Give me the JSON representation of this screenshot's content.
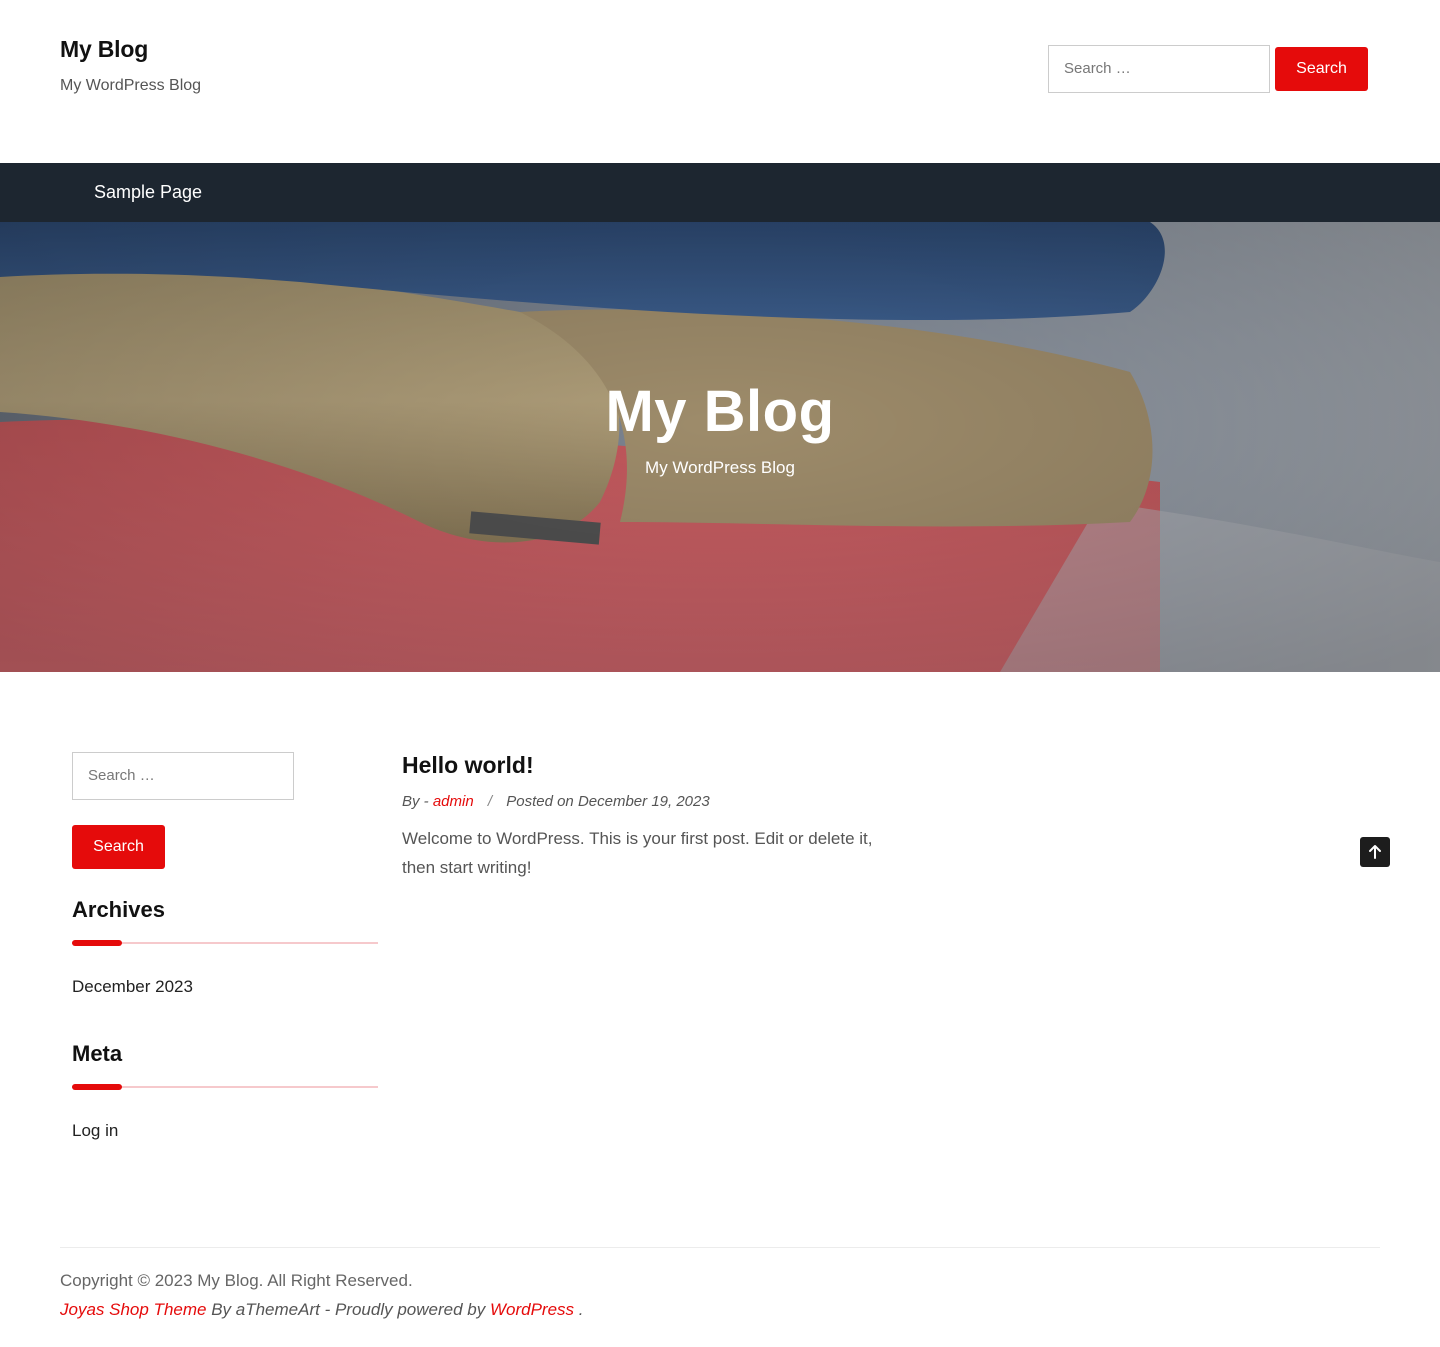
{
  "header": {
    "site_title": "My Blog",
    "site_description": "My WordPress Blog",
    "search": {
      "placeholder": "Search …",
      "button_label": "Search"
    }
  },
  "nav": {
    "items": [
      {
        "label": "Sample Page"
      }
    ]
  },
  "hero": {
    "title": "My Blog",
    "description": "My WordPress Blog"
  },
  "sidebar": {
    "search": {
      "placeholder": "Search …",
      "button_label": "Search"
    },
    "archives": {
      "title": "Archives",
      "items": [
        "December 2023"
      ]
    },
    "meta": {
      "title": "Meta",
      "items": [
        "Log in"
      ]
    }
  },
  "post": {
    "title": "Hello world!",
    "by_label": "By -",
    "author": "admin",
    "separator": "/",
    "posted_label": "Posted on",
    "date": "December 19, 2023",
    "excerpt": "Welcome to WordPress. This is your first post. Edit or delete it, then start writing!"
  },
  "footer": {
    "copyright": "Copyright © 2023 My Blog. All Right Reserved.",
    "theme_link": "Joyas Shop Theme",
    "by_text": "By aThemeArt - Proudly powered by",
    "wp_link": "WordPress",
    "end": "."
  },
  "icons": {
    "scroll_top": "arrow-up-icon"
  },
  "colors": {
    "accent": "#e50b0b",
    "nav_bg": "#1d2630",
    "text_dark": "#111111"
  }
}
